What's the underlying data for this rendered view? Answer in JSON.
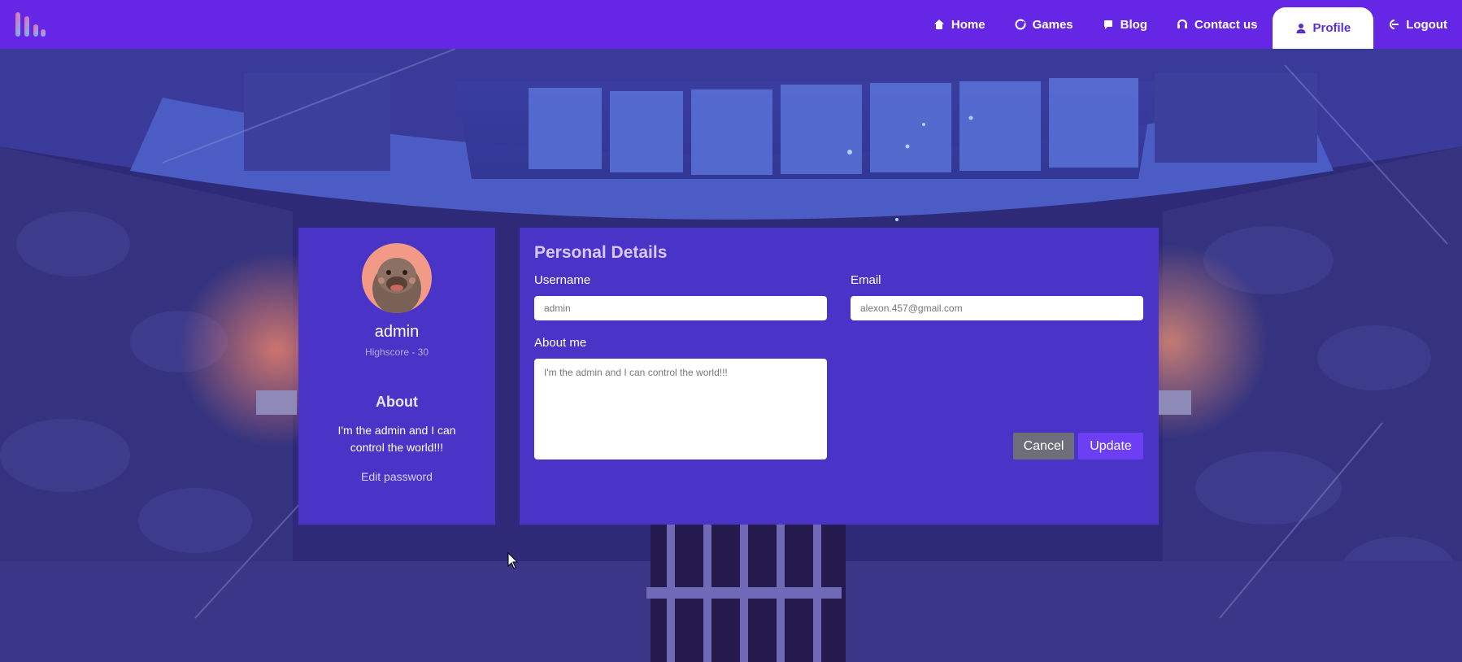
{
  "nav": {
    "items": [
      {
        "label": "Home",
        "icon": "home-icon"
      },
      {
        "label": "Games",
        "icon": "games-icon"
      },
      {
        "label": "Blog",
        "icon": "blog-icon"
      },
      {
        "label": "Contact us",
        "icon": "headset-icon"
      },
      {
        "label": "Profile",
        "icon": "user-icon",
        "active": true
      },
      {
        "label": "Logout",
        "icon": "logout-icon"
      }
    ],
    "color": "#6526e6"
  },
  "profile": {
    "name": "admin",
    "highscore": "Highscore - 30",
    "about_title": "About",
    "about_text": "I'm the admin and I can control the world!!!",
    "edit_password": "Edit password"
  },
  "details": {
    "title": "Personal Details",
    "username_label": "Username",
    "username_value": "admin",
    "email_label": "Email",
    "email_value": "alexon.457@gmail.com",
    "about_label": "About me",
    "about_value": "I'm the admin and I can control the world!!!",
    "cancel_label": "Cancel",
    "update_label": "Update"
  },
  "colors": {
    "card": "#4a34c8",
    "accent": "#6c3ff5",
    "cancel": "#6c6f7a"
  }
}
